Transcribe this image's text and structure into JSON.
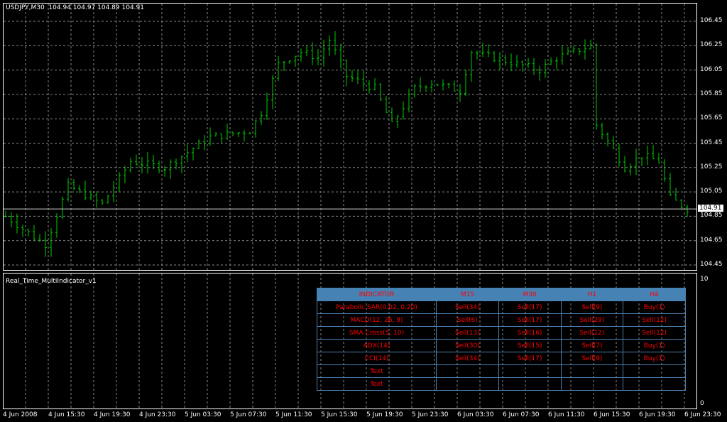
{
  "header": {
    "symbol": "USDJPY,M30",
    "ohlc": "104.94 104.97 104.89 104.91"
  },
  "price_axis": [
    "106.45",
    "106.25",
    "106.05",
    "105.85",
    "105.65",
    "105.45",
    "105.25",
    "105.05",
    "104.85",
    "104.65",
    "104.45"
  ],
  "current_price": "104.91",
  "time_axis": [
    "4 Jun 2008",
    "4 Jun 15:30",
    "4 Jun 19:30",
    "4 Jun 23:30",
    "5 Jun 03:30",
    "5 Jun 07:30",
    "5 Jun 11:30",
    "5 Jun 15:30",
    "5 Jun 19:30",
    "5 Jun 23:30",
    "6 Jun 03:30",
    "6 Jun 07:30",
    "6 Jun 11:30",
    "6 Jun 15:30",
    "6 Jun 19:30",
    "6 Jun 23:30"
  ],
  "indicator": {
    "title": "Real_Time_MultiIndicator_v1",
    "scale_max": "10",
    "scale_min": "0",
    "table": {
      "headers": [
        "INDICATOR",
        "M15",
        "M30",
        "H1",
        "H4"
      ],
      "rows": [
        [
          "Parabolic SAR(0.02, 0.20)",
          "Sell(34)",
          "Sell(17)",
          "Sell(9)",
          "Buy(1)"
        ],
        [
          "MACD(12, 26, 9)",
          "Sell(6)",
          "Sell(17)",
          "Sell(29)",
          "Sell(12)"
        ],
        [
          "SMA Cross(5, 10)",
          "Sell(13)",
          "Sell(16)",
          "Sell(12)",
          "Sell(12)"
        ],
        [
          "ADX(14)",
          "Sell(30)",
          "Sell(15)",
          "Sell(7)",
          "Buy(1)"
        ],
        [
          "CCI(14)",
          "Sell(34)",
          "Sell(17)",
          "Sell(9)",
          "Buy(1)"
        ],
        [
          "Text",
          "",
          "",
          "",
          ""
        ],
        [
          "Text",
          "",
          "",
          "",
          ""
        ]
      ]
    }
  },
  "chart_data": {
    "type": "ohlc",
    "ylim": [
      104.45,
      106.45
    ],
    "bar_color": "#00ff00",
    "close_keypoints": [
      [
        0,
        104.85
      ],
      [
        5,
        104.68
      ],
      [
        7,
        104.62
      ],
      [
        11,
        105.1
      ],
      [
        17,
        104.95
      ],
      [
        22,
        105.3
      ],
      [
        28,
        105.25
      ],
      [
        36,
        105.5
      ],
      [
        43,
        105.55
      ],
      [
        45,
        105.7
      ],
      [
        48,
        106.1
      ],
      [
        52,
        106.2
      ],
      [
        55,
        106.15
      ],
      [
        57,
        106.3
      ],
      [
        60,
        106.0
      ],
      [
        65,
        105.9
      ],
      [
        68,
        105.6
      ],
      [
        72,
        105.9
      ],
      [
        75,
        105.95
      ],
      [
        80,
        105.88
      ],
      [
        82,
        106.2
      ],
      [
        86,
        106.15
      ],
      [
        90,
        106.1
      ],
      [
        94,
        106.05
      ],
      [
        97,
        106.15
      ],
      [
        103,
        106.25
      ],
      [
        104,
        105.6
      ],
      [
        107,
        105.4
      ],
      [
        109,
        105.25
      ],
      [
        112,
        105.35
      ],
      [
        115,
        105.3
      ],
      [
        117,
        105.0
      ],
      [
        120,
        104.91
      ]
    ]
  }
}
